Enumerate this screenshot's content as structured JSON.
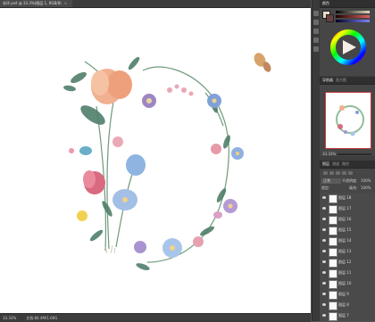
{
  "document": {
    "tab_title": "花环.psd @ 33.3%(图层 1, RGB/8)"
  },
  "status": {
    "zoom": "33.33%",
    "doc_size": "文档:84.4M/1.60G"
  },
  "panels": {
    "color": {
      "label": "颜色"
    },
    "navigator": {
      "tabs": [
        "导航器",
        "直方图"
      ],
      "zoom": "33.33%"
    },
    "layers": {
      "tabs": [
        "图层",
        "通道",
        "路径"
      ],
      "blend_mode": "正常",
      "opacity_label": "不透明度:",
      "opacity_value": "100%",
      "lock_label": "锁定:",
      "fill_label": "填充:",
      "fill_value": "100%",
      "items": [
        {
          "name": "图层 18"
        },
        {
          "name": "图层 17"
        },
        {
          "name": "图层 16"
        },
        {
          "name": "图层 15"
        },
        {
          "name": "图层 14"
        },
        {
          "name": "图层 13"
        },
        {
          "name": "图层 12"
        },
        {
          "name": "图层 11"
        },
        {
          "name": "图层 10"
        },
        {
          "name": "图层 9"
        },
        {
          "name": "图层 8"
        },
        {
          "name": "图层 7"
        }
      ]
    }
  },
  "colors": {
    "foreground": "#e8dcc8",
    "background": "#6a3f3f",
    "accent": "#c23b3b"
  }
}
